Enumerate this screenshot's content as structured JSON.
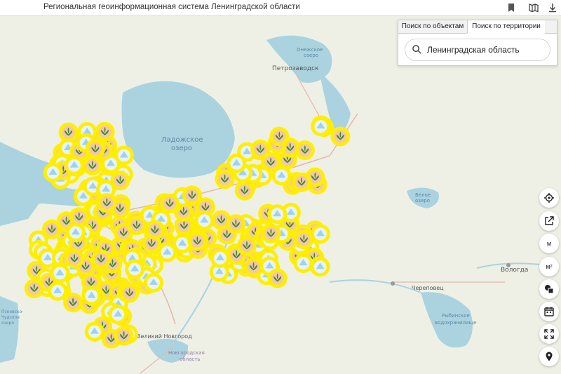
{
  "app": {
    "title": "Региональная геоинформационная система Ленинградской области"
  },
  "topbar_icons": [
    "bookmark-icon",
    "map-book-icon",
    "download-icon"
  ],
  "search_panel": {
    "tabs": [
      {
        "label": "Поиск по объектам",
        "active": false
      },
      {
        "label": "Поиск по территории",
        "active": true
      }
    ],
    "query": "Ленинградская область"
  },
  "map": {
    "labels": {
      "petrozavodsk": "Петрозаводск",
      "onega_1": "Онежское",
      "onega_2": "озеро",
      "ladoga_1": "Ладожское",
      "ladoga_2": "озеро",
      "beloe_1": "Белое",
      "beloe_2": "озеро",
      "vologda": "Вологда",
      "cherepovets": "Череповец",
      "rybinsk_1": "Рыбинское",
      "rybinsk_2": "водохранилище",
      "velikiy_novgorod": "Великий Новгород",
      "novgorod_region_1": "Новгородская",
      "novgorod_region_2": "область",
      "pskov_1": "Псковско-",
      "pskov_2": "Чудское",
      "pskov_3": "озеро"
    },
    "marker_colors": {
      "halo": "#ffee00",
      "inner": "#f4c7a8",
      "sprout": "#3d8b3a",
      "snow": "#9ed2ef"
    }
  },
  "controls": [
    {
      "name": "geolocate-button",
      "icon": "crosshair-icon",
      "label": ""
    },
    {
      "name": "external-link-button",
      "icon": "external-link-icon",
      "label": ""
    },
    {
      "name": "measure-length-button",
      "icon": "",
      "label": "м"
    },
    {
      "name": "measure-area-button",
      "icon": "",
      "label": "м²"
    },
    {
      "name": "layers-button",
      "icon": "shapes-icon",
      "label": ""
    },
    {
      "name": "calendar-button",
      "icon": "calendar-icon",
      "label": ""
    },
    {
      "name": "fullscreen-button",
      "icon": "expand-icon",
      "label": ""
    },
    {
      "name": "place-pin-button",
      "icon": "pin-icon",
      "label": ""
    }
  ]
}
